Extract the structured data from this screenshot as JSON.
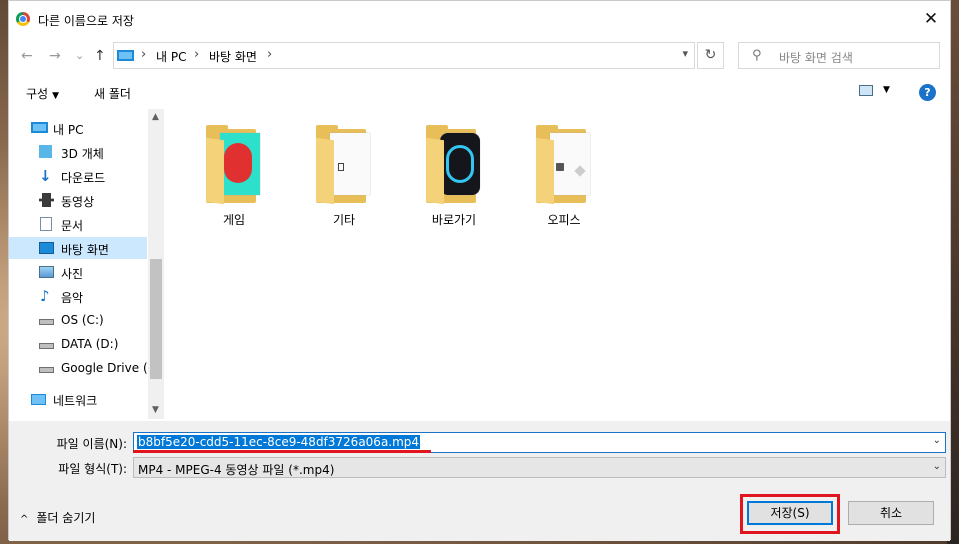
{
  "window": {
    "title": "다른 이름으로 저장",
    "close_glyph": "✕"
  },
  "nav": {
    "back": "←",
    "forward": "→",
    "recent": "⌄",
    "up": "↑",
    "breadcrumb": [
      "내 PC",
      "바탕 화면"
    ],
    "breadcrumb_separator": "›",
    "refresh": "↻",
    "search_icon": "⚲",
    "search_placeholder": "바탕 화면 검색"
  },
  "toolbar": {
    "organize_label": "구성",
    "new_folder_label": "새 폴더",
    "help_label": "?"
  },
  "sidebar": {
    "items": [
      {
        "label": "내 PC",
        "icon": "pc-icon"
      },
      {
        "label": "3D 개체",
        "icon": "3d-objects-icon"
      },
      {
        "label": "다운로드",
        "icon": "download-icon"
      },
      {
        "label": "동영상",
        "icon": "video-icon"
      },
      {
        "label": "문서",
        "icon": "document-icon"
      },
      {
        "label": "바탕 화면",
        "icon": "desktop-icon",
        "selected": true
      },
      {
        "label": "사진",
        "icon": "pictures-icon"
      },
      {
        "label": "음악",
        "icon": "music-icon"
      },
      {
        "label": "OS (C:)",
        "icon": "drive-icon"
      },
      {
        "label": "DATA (D:)",
        "icon": "drive-icon"
      },
      {
        "label": "Google Drive (G",
        "icon": "drive-icon"
      },
      {
        "label": "네트워크",
        "icon": "network-icon"
      }
    ]
  },
  "folders": [
    {
      "label": "게임"
    },
    {
      "label": "기타"
    },
    {
      "label": "바로가기"
    },
    {
      "label": "오피스"
    }
  ],
  "form": {
    "filename_label": "파일 이름(N):",
    "filename_value": "b8bf5e20-cdd5-11ec-8ce9-48df3726a06a.mp4",
    "filetype_label": "파일 형식(T):",
    "filetype_value": "MP4 - MPEG-4 동영상 파일 (*.mp4)"
  },
  "footer": {
    "hide_folders_label": "폴더 숨기기",
    "save_label": "저장(S)",
    "cancel_label": "취소"
  },
  "colors": {
    "accent": "#0078d7",
    "highlight_red": "#e01520",
    "selected_bg": "#cce8ff",
    "folder_yellow": "#e8be58"
  }
}
